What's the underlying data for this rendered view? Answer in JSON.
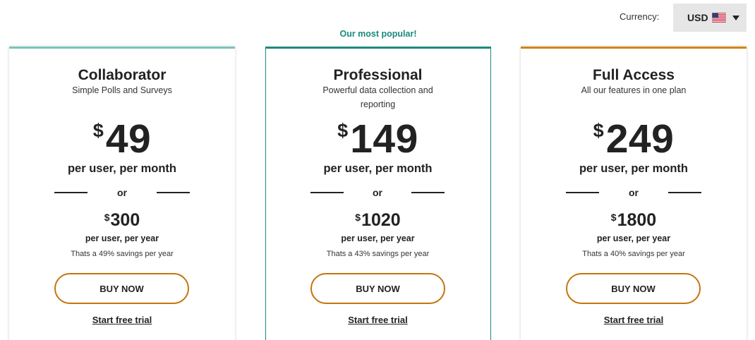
{
  "currency": {
    "label": "Currency:",
    "selected": "USD",
    "flag_icon": "us-flag-icon"
  },
  "badge": "Our most popular!",
  "colors": {
    "teal": "#1a8a7c",
    "light_teal": "#7cc3bd",
    "orange": "#d68410",
    "button_border": "#c5740e"
  },
  "plans": [
    {
      "name": "Collaborator",
      "subtitle": "Simple Polls and Surveys",
      "currency_symbol": "$",
      "price": "49",
      "period": "per user, per month",
      "or": "or",
      "yearly_symbol": "$",
      "yearly_price": "300",
      "yearly_period": "per user, per year",
      "savings": "Thats a 49% savings per year",
      "buy_label": "BUY NOW",
      "trial_label": "Start free trial"
    },
    {
      "name": "Professional",
      "subtitle": "Powerful data collection and reporting",
      "currency_symbol": "$",
      "price": "149",
      "period": "per user, per month",
      "or": "or",
      "yearly_symbol": "$",
      "yearly_price": "1020",
      "yearly_period": "per user, per year",
      "savings": "Thats a 43% savings per year",
      "buy_label": "BUY NOW",
      "trial_label": "Start free trial"
    },
    {
      "name": "Full Access",
      "subtitle": "All our features in one plan",
      "currency_symbol": "$",
      "price": "249",
      "period": "per user, per month",
      "or": "or",
      "yearly_symbol": "$",
      "yearly_price": "1800",
      "yearly_period": "per user, per year",
      "savings": "Thats a 40% savings per year",
      "buy_label": "BUY NOW",
      "trial_label": "Start free trial"
    }
  ]
}
